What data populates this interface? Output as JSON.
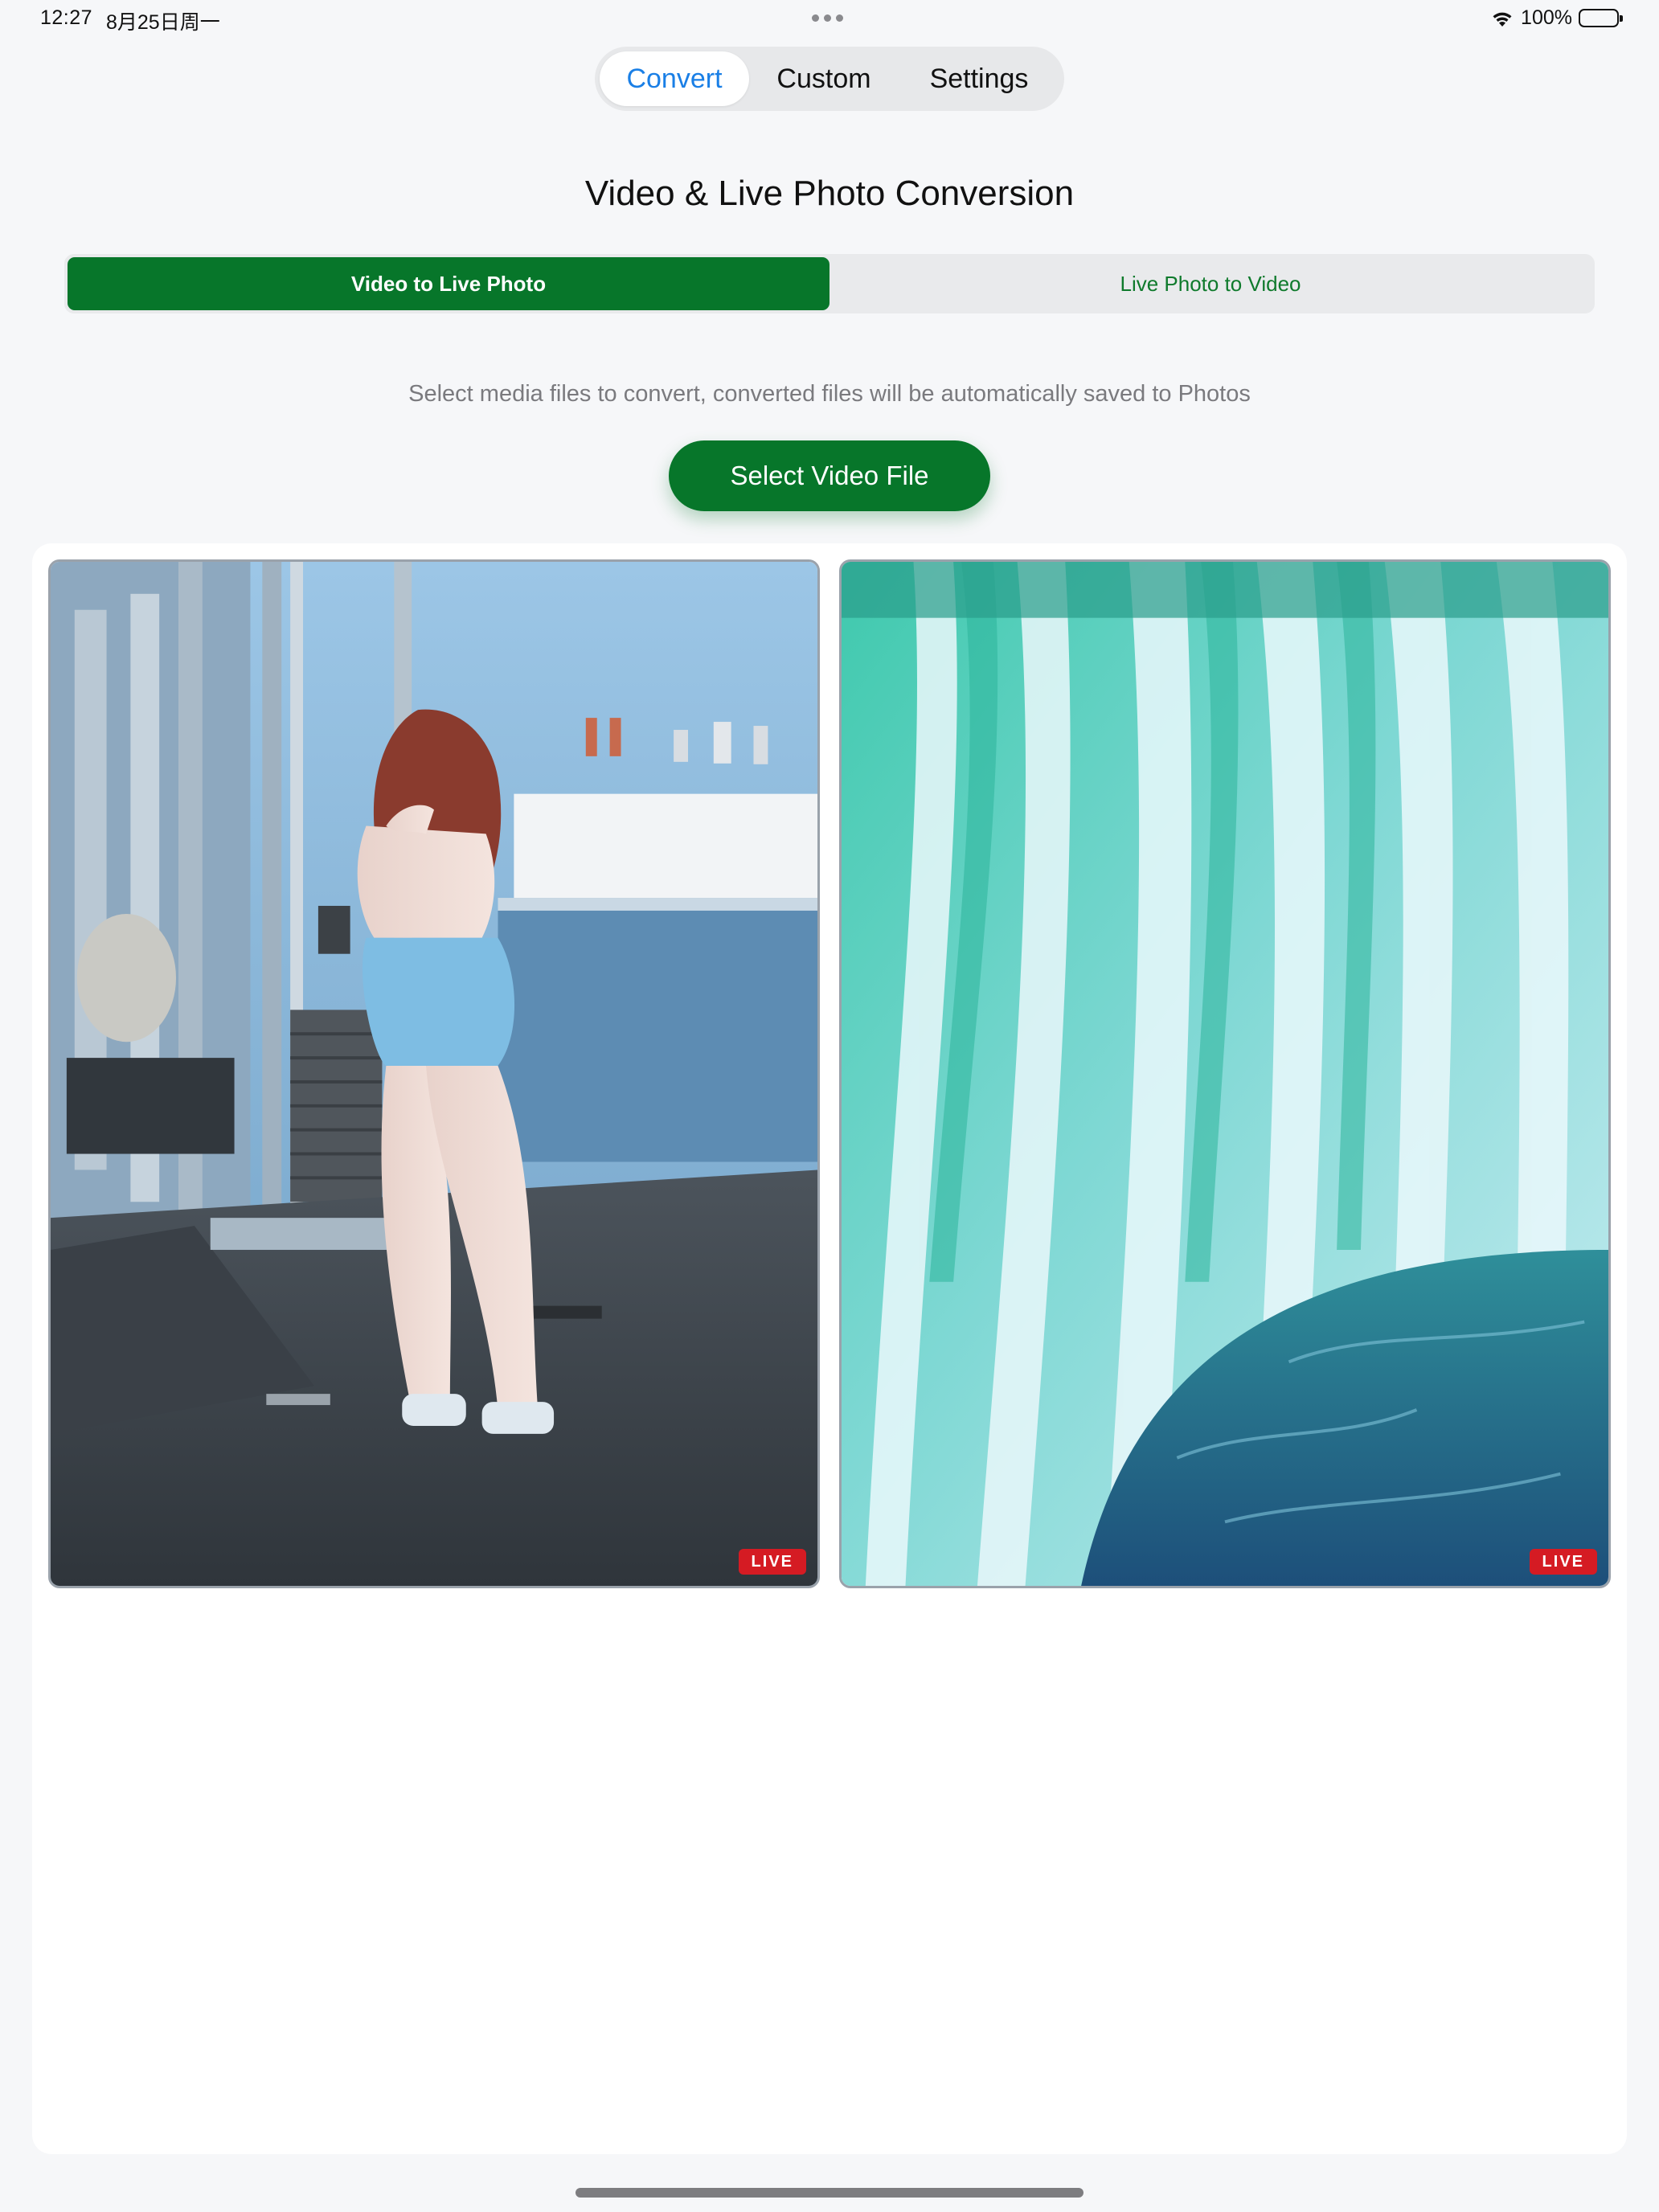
{
  "status_bar": {
    "time": "12:27",
    "date": "8月25日周一",
    "battery": "100%"
  },
  "top_tabs": [
    {
      "label": "Convert",
      "active": true
    },
    {
      "label": "Custom",
      "active": false
    },
    {
      "label": "Settings",
      "active": false
    }
  ],
  "title": "Video & Live Photo Conversion",
  "mode": {
    "options": [
      "Video to Live Photo",
      "Live Photo to Video"
    ],
    "selected": "Video to Live Photo"
  },
  "description": "Select media files to convert, converted files will be automatically saved to Photos",
  "select_button_label": "Select Video File",
  "gallery": {
    "items": [
      {
        "badge": "LIVE"
      },
      {
        "badge": "LIVE"
      }
    ]
  },
  "colors": {
    "accent_green": "#07762a",
    "tab_blue": "#1a7fe6",
    "live_red": "#d51b23",
    "background": "#f6f7f9"
  },
  "icons": [
    "wifi-icon",
    "battery-icon",
    "more-dots-icon"
  ]
}
